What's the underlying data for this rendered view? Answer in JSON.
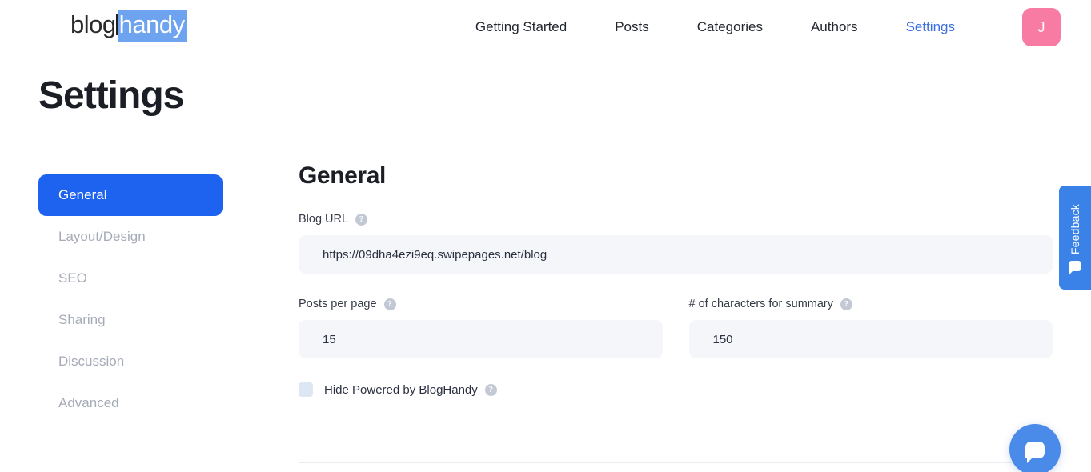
{
  "header": {
    "logo": {
      "part1": "blog",
      "part2": "handy",
      "highlight_color": "#6ea3f0"
    },
    "nav": [
      {
        "label": "Getting Started",
        "active": false
      },
      {
        "label": "Posts",
        "active": false
      },
      {
        "label": "Categories",
        "active": false
      },
      {
        "label": "Authors",
        "active": false
      },
      {
        "label": "Settings",
        "active": true
      }
    ],
    "avatar": {
      "initial": "J",
      "color": "#f87ba3"
    }
  },
  "page": {
    "title": "Settings"
  },
  "sidebar": {
    "items": [
      {
        "label": "General"
      },
      {
        "label": "Layout/Design"
      },
      {
        "label": "SEO"
      },
      {
        "label": "Sharing"
      },
      {
        "label": "Discussion"
      },
      {
        "label": "Advanced"
      }
    ],
    "active_color": "#1d63f0"
  },
  "main": {
    "section_title": "General",
    "help_glyph": "?",
    "blog_url": {
      "label": "Blog URL",
      "value": "https://09dha4ezi9eq.swipepages.net/blog",
      "placeholder": "https://"
    },
    "posts_per_page": {
      "label": "Posts per page",
      "value": "15",
      "placeholder": "15"
    },
    "characters_summary": {
      "label": "# of characters for summary",
      "value": "150",
      "placeholder": "150"
    },
    "hide_powered_by": {
      "label": "Hide Powered by BlogHandy",
      "checked": false
    }
  },
  "widgets": {
    "feedback": {
      "label": "Feedback",
      "color": "#3b82e8"
    },
    "chat": {
      "color": "#4a8ae8"
    }
  }
}
